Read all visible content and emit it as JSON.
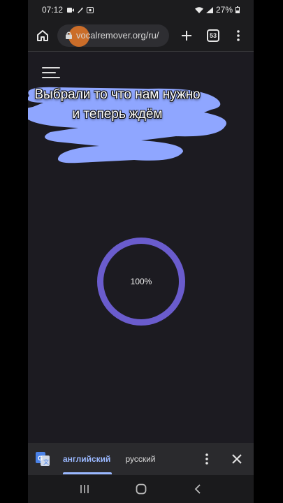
{
  "status_bar": {
    "time": "07:12",
    "battery": "27%"
  },
  "browser": {
    "url": "vocalremover.org/ru/",
    "tab_count": "53",
    "icons": [
      "home-icon",
      "lock-icon",
      "plus-icon",
      "tabs-icon",
      "more-vert-icon"
    ]
  },
  "page": {
    "caption_line1": "Выбрали то что нам нужно",
    "caption_line2": "и теперь ждём",
    "progress_text": "100%",
    "progress_value": 1.0,
    "accent_color": "#6a5ccd",
    "highlight_color": "#8fa6ff"
  },
  "translate_bar": {
    "lang_source": "английский",
    "lang_target": "русский",
    "active_color": "#9ab8ff"
  },
  "nav_bar": {
    "icons": [
      "recents-icon",
      "home-circle-icon",
      "back-icon"
    ]
  }
}
